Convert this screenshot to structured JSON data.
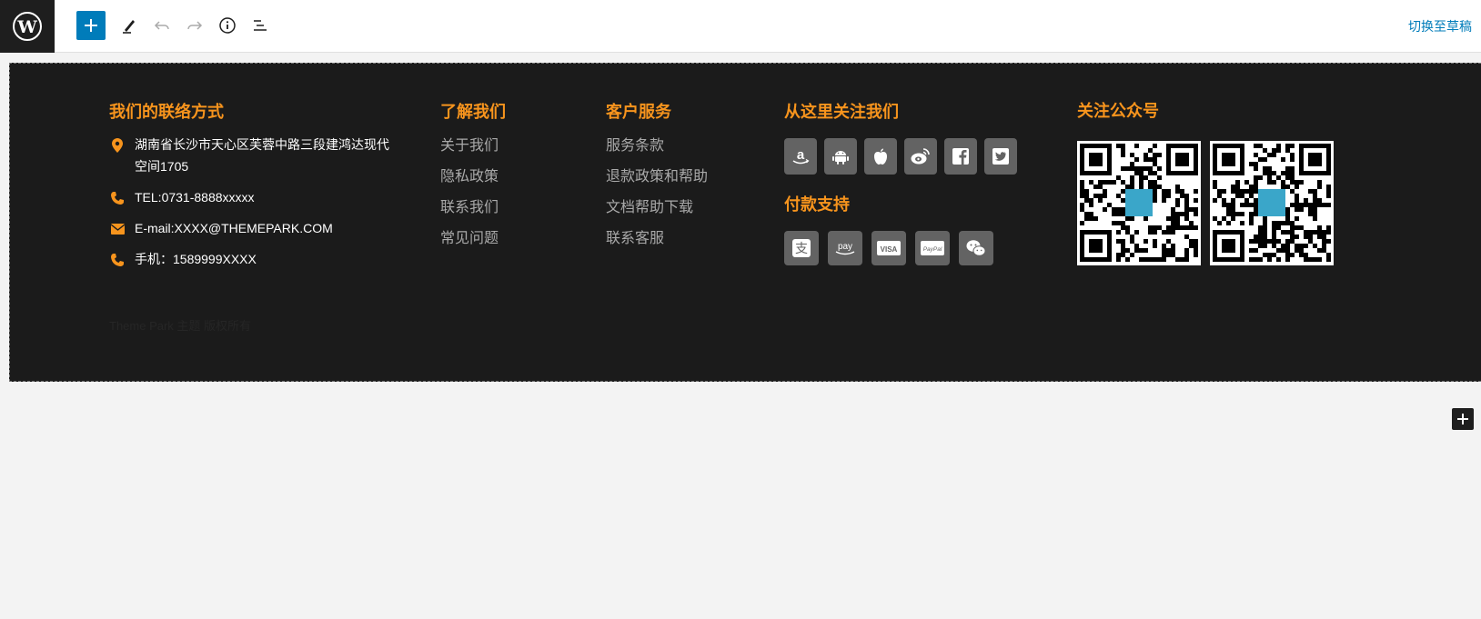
{
  "toolbar": {
    "logo_icon": "wordpress-icon",
    "add_icon": "plus-icon",
    "edit_icon": "pencil-icon",
    "undo_icon": "undo-icon",
    "redo_icon": "redo-icon",
    "info_icon": "info-icon",
    "outline_icon": "list-view-icon",
    "switch_draft_label": "切换至草稿",
    "accent_color": "#007cba"
  },
  "footer": {
    "background": "#1b1b1b",
    "title_color": "#f7941d",
    "contact": {
      "title": "我们的联络方式",
      "items": [
        {
          "icon": "location-pin-icon",
          "text": "湖南省长沙市天心区芙蓉中路三段建鸿达现代空间1705"
        },
        {
          "icon": "phone-icon",
          "text": "TEL:0731-8888xxxxx"
        },
        {
          "icon": "envelope-icon",
          "text": "E-mail:XXXX@THEMEPARK.COM"
        },
        {
          "icon": "phone-icon",
          "text": "手机：1589999XXXX"
        }
      ],
      "footnote": "Theme Park 主题 版权所有"
    },
    "about": {
      "title": "了解我们",
      "links": [
        "关于我们",
        "隐私政策",
        "联系我们",
        "常见问题"
      ]
    },
    "service": {
      "title": "客户服务",
      "links": [
        "服务条款",
        "退款政策和帮助",
        "文档帮助下载",
        "联系客服"
      ]
    },
    "follow": {
      "title": "从这里关注我们",
      "icons": [
        "amazon-icon",
        "android-icon",
        "apple-icon",
        "weibo-icon",
        "facebook-icon",
        "twitter-icon"
      ]
    },
    "payment": {
      "title": "付款支持",
      "icons": [
        "alipay-icon",
        "amazon-pay-icon",
        "visa-icon",
        "paypal-icon",
        "wechat-icon"
      ]
    },
    "qr": {
      "title": "关注公众号",
      "codes": [
        "qr-code",
        "qr-code"
      ]
    }
  }
}
